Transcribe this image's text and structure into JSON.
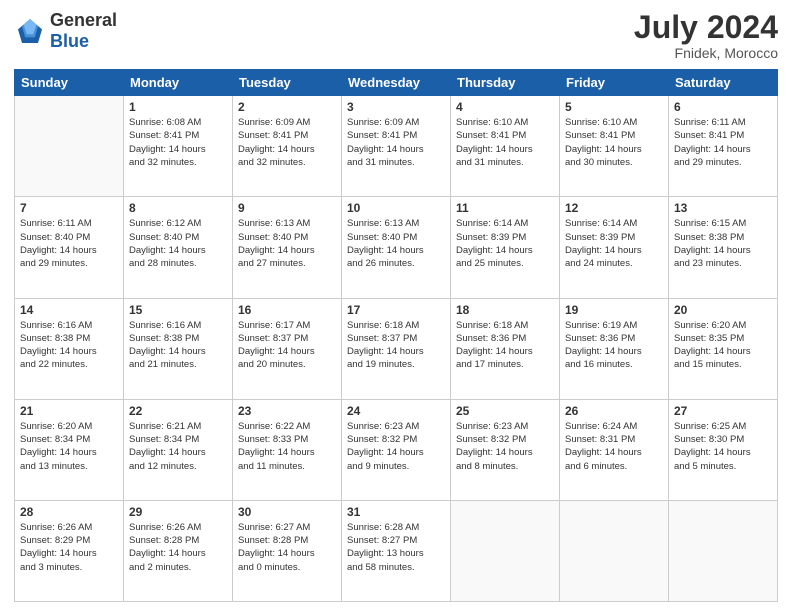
{
  "header": {
    "logo": {
      "general": "General",
      "blue": "Blue"
    },
    "title": "July 2024",
    "location": "Fnidek, Morocco"
  },
  "calendar": {
    "days_of_week": [
      "Sunday",
      "Monday",
      "Tuesday",
      "Wednesday",
      "Thursday",
      "Friday",
      "Saturday"
    ],
    "weeks": [
      [
        {
          "day": null,
          "info": null
        },
        {
          "day": "1",
          "info": "Sunrise: 6:08 AM\nSunset: 8:41 PM\nDaylight: 14 hours\nand 32 minutes."
        },
        {
          "day": "2",
          "info": "Sunrise: 6:09 AM\nSunset: 8:41 PM\nDaylight: 14 hours\nand 32 minutes."
        },
        {
          "day": "3",
          "info": "Sunrise: 6:09 AM\nSunset: 8:41 PM\nDaylight: 14 hours\nand 31 minutes."
        },
        {
          "day": "4",
          "info": "Sunrise: 6:10 AM\nSunset: 8:41 PM\nDaylight: 14 hours\nand 31 minutes."
        },
        {
          "day": "5",
          "info": "Sunrise: 6:10 AM\nSunset: 8:41 PM\nDaylight: 14 hours\nand 30 minutes."
        },
        {
          "day": "6",
          "info": "Sunrise: 6:11 AM\nSunset: 8:41 PM\nDaylight: 14 hours\nand 29 minutes."
        }
      ],
      [
        {
          "day": "7",
          "info": "Sunrise: 6:11 AM\nSunset: 8:40 PM\nDaylight: 14 hours\nand 29 minutes."
        },
        {
          "day": "8",
          "info": "Sunrise: 6:12 AM\nSunset: 8:40 PM\nDaylight: 14 hours\nand 28 minutes."
        },
        {
          "day": "9",
          "info": "Sunrise: 6:13 AM\nSunset: 8:40 PM\nDaylight: 14 hours\nand 27 minutes."
        },
        {
          "day": "10",
          "info": "Sunrise: 6:13 AM\nSunset: 8:40 PM\nDaylight: 14 hours\nand 26 minutes."
        },
        {
          "day": "11",
          "info": "Sunrise: 6:14 AM\nSunset: 8:39 PM\nDaylight: 14 hours\nand 25 minutes."
        },
        {
          "day": "12",
          "info": "Sunrise: 6:14 AM\nSunset: 8:39 PM\nDaylight: 14 hours\nand 24 minutes."
        },
        {
          "day": "13",
          "info": "Sunrise: 6:15 AM\nSunset: 8:38 PM\nDaylight: 14 hours\nand 23 minutes."
        }
      ],
      [
        {
          "day": "14",
          "info": "Sunrise: 6:16 AM\nSunset: 8:38 PM\nDaylight: 14 hours\nand 22 minutes."
        },
        {
          "day": "15",
          "info": "Sunrise: 6:16 AM\nSunset: 8:38 PM\nDaylight: 14 hours\nand 21 minutes."
        },
        {
          "day": "16",
          "info": "Sunrise: 6:17 AM\nSunset: 8:37 PM\nDaylight: 14 hours\nand 20 minutes."
        },
        {
          "day": "17",
          "info": "Sunrise: 6:18 AM\nSunset: 8:37 PM\nDaylight: 14 hours\nand 19 minutes."
        },
        {
          "day": "18",
          "info": "Sunrise: 6:18 AM\nSunset: 8:36 PM\nDaylight: 14 hours\nand 17 minutes."
        },
        {
          "day": "19",
          "info": "Sunrise: 6:19 AM\nSunset: 8:36 PM\nDaylight: 14 hours\nand 16 minutes."
        },
        {
          "day": "20",
          "info": "Sunrise: 6:20 AM\nSunset: 8:35 PM\nDaylight: 14 hours\nand 15 minutes."
        }
      ],
      [
        {
          "day": "21",
          "info": "Sunrise: 6:20 AM\nSunset: 8:34 PM\nDaylight: 14 hours\nand 13 minutes."
        },
        {
          "day": "22",
          "info": "Sunrise: 6:21 AM\nSunset: 8:34 PM\nDaylight: 14 hours\nand 12 minutes."
        },
        {
          "day": "23",
          "info": "Sunrise: 6:22 AM\nSunset: 8:33 PM\nDaylight: 14 hours\nand 11 minutes."
        },
        {
          "day": "24",
          "info": "Sunrise: 6:23 AM\nSunset: 8:32 PM\nDaylight: 14 hours\nand 9 minutes."
        },
        {
          "day": "25",
          "info": "Sunrise: 6:23 AM\nSunset: 8:32 PM\nDaylight: 14 hours\nand 8 minutes."
        },
        {
          "day": "26",
          "info": "Sunrise: 6:24 AM\nSunset: 8:31 PM\nDaylight: 14 hours\nand 6 minutes."
        },
        {
          "day": "27",
          "info": "Sunrise: 6:25 AM\nSunset: 8:30 PM\nDaylight: 14 hours\nand 5 minutes."
        }
      ],
      [
        {
          "day": "28",
          "info": "Sunrise: 6:26 AM\nSunset: 8:29 PM\nDaylight: 14 hours\nand 3 minutes."
        },
        {
          "day": "29",
          "info": "Sunrise: 6:26 AM\nSunset: 8:28 PM\nDaylight: 14 hours\nand 2 minutes."
        },
        {
          "day": "30",
          "info": "Sunrise: 6:27 AM\nSunset: 8:28 PM\nDaylight: 14 hours\nand 0 minutes."
        },
        {
          "day": "31",
          "info": "Sunrise: 6:28 AM\nSunset: 8:27 PM\nDaylight: 13 hours\nand 58 minutes."
        },
        {
          "day": null,
          "info": null
        },
        {
          "day": null,
          "info": null
        },
        {
          "day": null,
          "info": null
        }
      ]
    ]
  }
}
